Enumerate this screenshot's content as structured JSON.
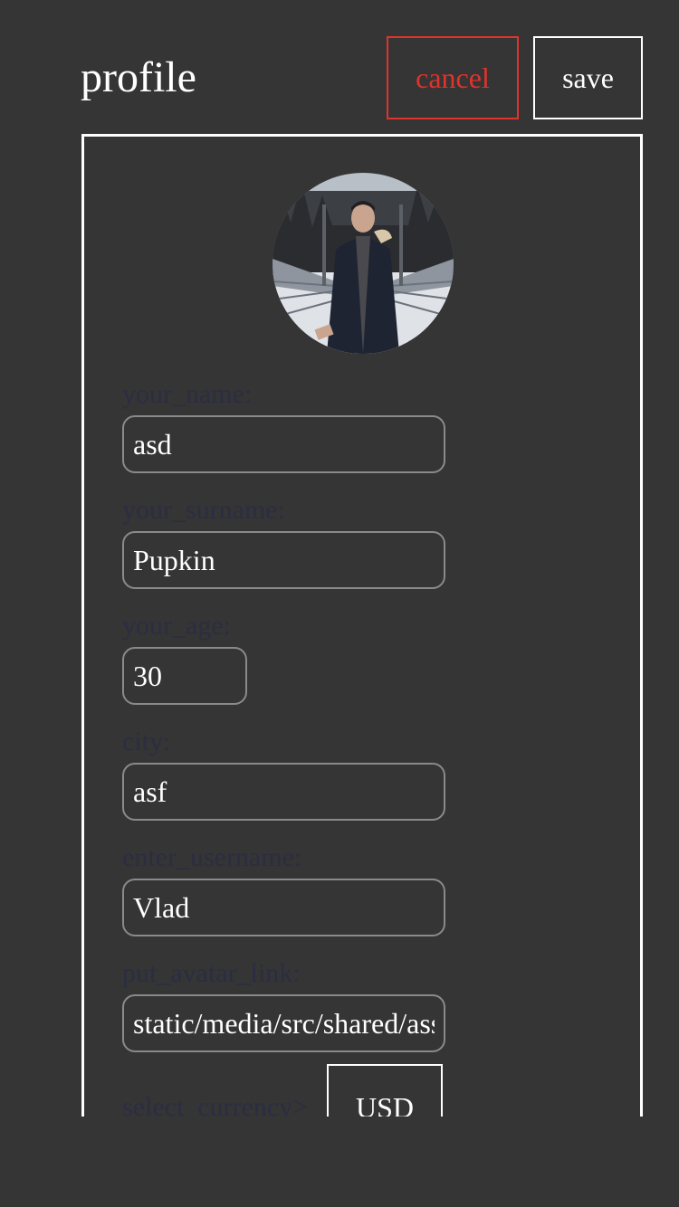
{
  "header": {
    "title": "profile",
    "cancel_label": "cancel",
    "save_label": "save"
  },
  "form": {
    "name": {
      "label": "your_name:",
      "value": "asd"
    },
    "surname": {
      "label": "your_surname:",
      "value": "Pupkin"
    },
    "age": {
      "label": "your_age:",
      "value": "30"
    },
    "city": {
      "label": "city:",
      "value": "asf"
    },
    "username": {
      "label": "enter_username:",
      "value": "Vlad"
    },
    "avatar_link": {
      "label": "put_avatar_link:",
      "value": "static/media/src/shared/assets/avatar.jpg"
    },
    "currency": {
      "label": "select_currency>",
      "value": "USD"
    }
  },
  "colors": {
    "background": "#353535",
    "cancel_accent": "#e0332b",
    "label_text": "#2b2d42",
    "input_border": "#8a8a8a"
  },
  "icons": {
    "avatar": "profile-photo"
  }
}
